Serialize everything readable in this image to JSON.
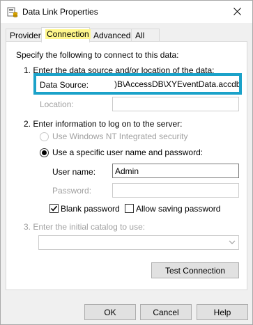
{
  "window": {
    "title": "Data Link Properties",
    "close_icon": "close-icon",
    "app_icon": "data-link-icon"
  },
  "tabs": [
    {
      "label": "Provider",
      "active": false
    },
    {
      "label": "Connection",
      "active": true
    },
    {
      "label": "Advanced",
      "active": false
    },
    {
      "label": "All",
      "active": false
    }
  ],
  "connection": {
    "intro": "Specify the following to connect to this data:",
    "step1": "1. Enter the data source and/or location of the data:",
    "data_source_label": "Data Source:",
    "data_source_value": ")B\\AccessDB\\XYEventData.accdb",
    "location_label": "Location:",
    "location_value": "",
    "step2": "2. Enter information to log on to the server:",
    "nt_security_label": "Use Windows NT Integrated security",
    "specific_user_label": "Use a specific user name and password:",
    "user_name_label": "User name:",
    "user_name_value": "Admin",
    "password_label": "Password:",
    "password_value": "",
    "blank_password_label": "Blank password",
    "blank_password_checked": true,
    "allow_saving_label": "Allow saving password",
    "allow_saving_checked": false,
    "step3": "3. Enter the initial catalog to use:",
    "catalog_value": "",
    "test_button": "Test Connection"
  },
  "footer": {
    "ok": "OK",
    "cancel": "Cancel",
    "help": "Help"
  },
  "colors": {
    "highlight_border": "#1ba2c9",
    "active_tab_highlight": "#fff78c"
  }
}
